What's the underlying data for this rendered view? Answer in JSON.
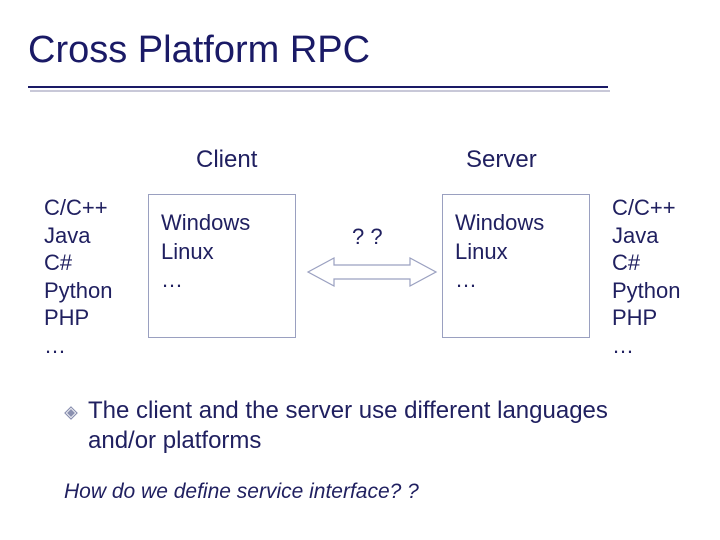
{
  "title": "Cross Platform RPC",
  "headers": {
    "client": "Client",
    "server": "Server"
  },
  "languages_left": "C/C++\nJava\nC#\nPython\nPHP\n…",
  "languages_right": "C/C++\nJava\nC#\nPython\nPHP\n…",
  "platforms_client": "Windows\nLinux\n…",
  "platforms_server": "Windows\nLinux\n…",
  "question_marks": "? ?",
  "bullet_text": "The client and the server use different languages and/or platforms",
  "footer_question": "How do we define service interface? ?"
}
